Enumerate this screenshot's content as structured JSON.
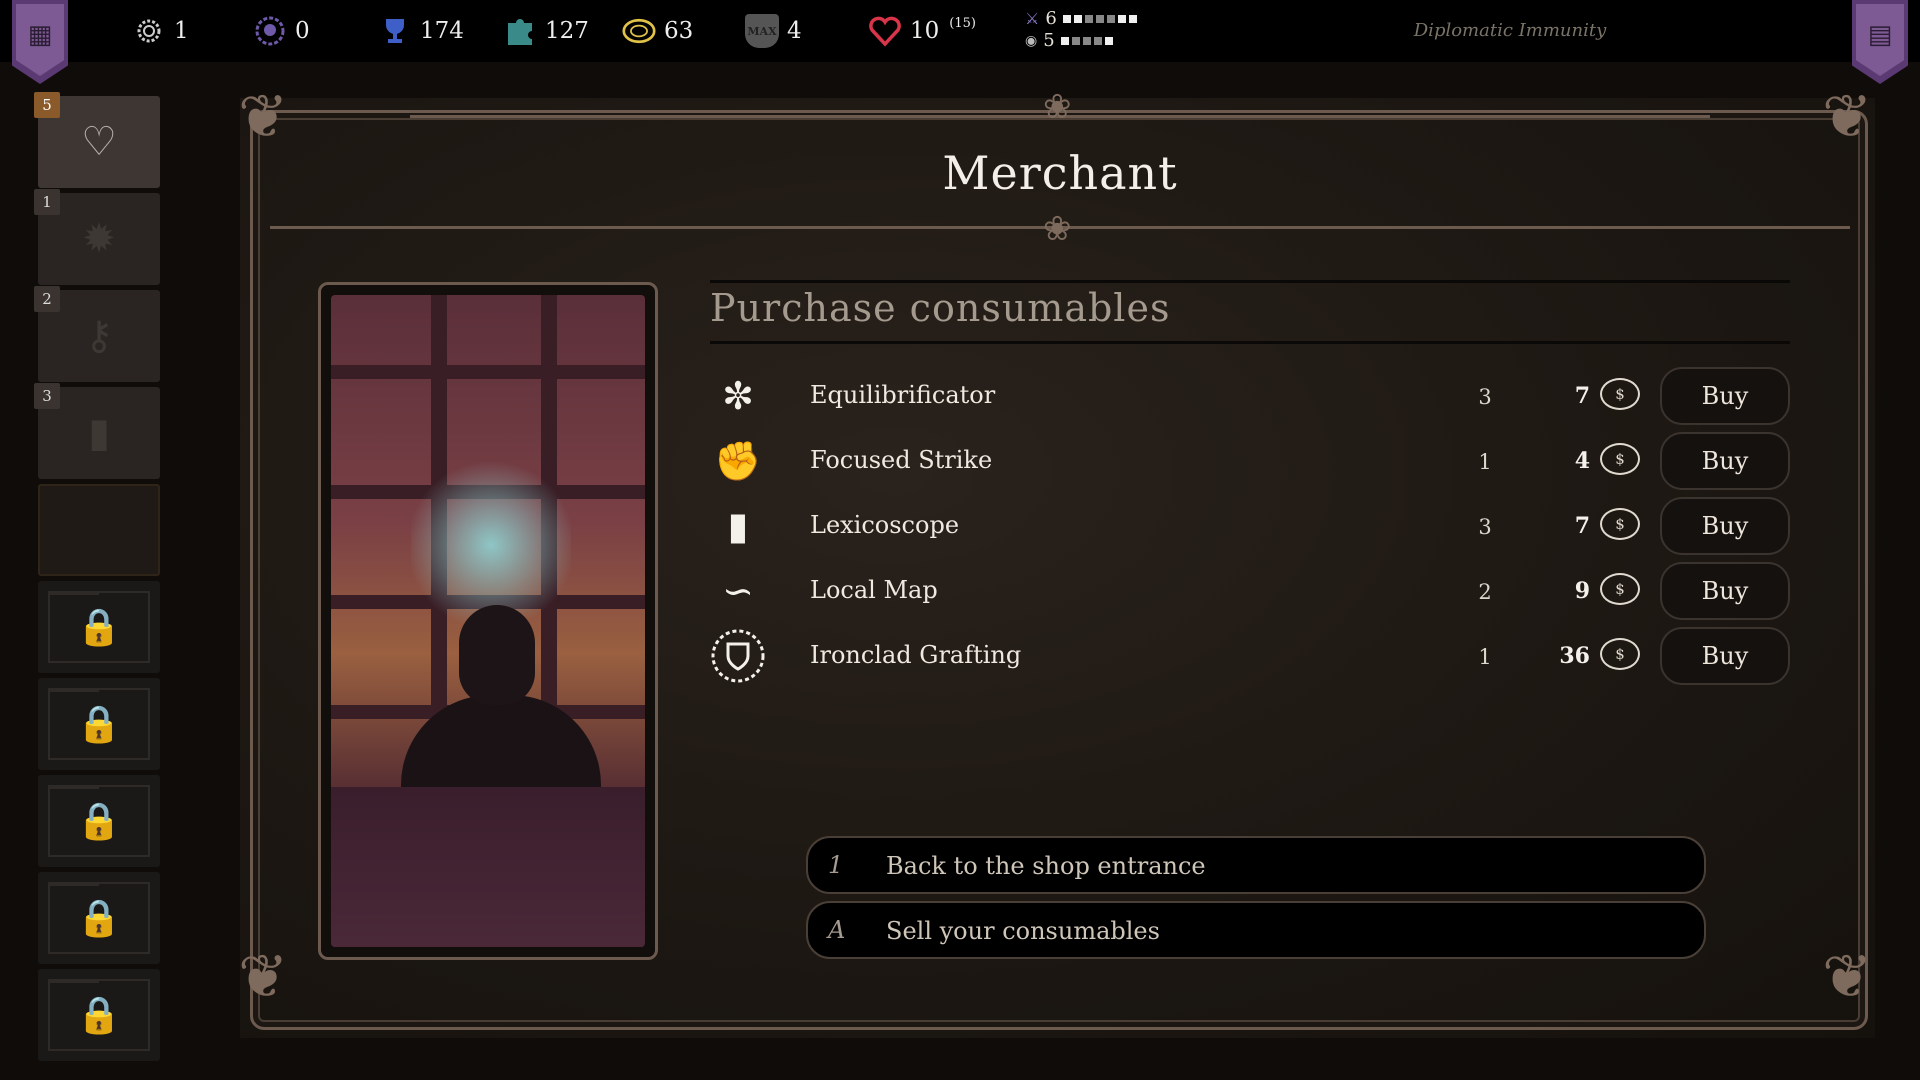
{
  "hud": {
    "gears": "1",
    "skulls": "0",
    "trophies": "174",
    "puzzle": "127",
    "coins": "63",
    "max": "4",
    "max_icon_label": "MAX",
    "hearts": "10",
    "hearts_max": "(15)",
    "attack": "6",
    "speed": "5",
    "location": "Diplomatic Immunity"
  },
  "sidebar": {
    "slots": [
      {
        "count": "5",
        "icon": "potion-heart-icon"
      },
      {
        "count": "1",
        "icon": "burst-icon"
      },
      {
        "count": "2",
        "icon": "key-icon"
      },
      {
        "count": "3",
        "icon": "bar-chart-icon"
      }
    ]
  },
  "panel": {
    "title": "Merchant",
    "section_title": "Purchase consumables"
  },
  "items": [
    {
      "name": "Equilibrificator",
      "qty": "3",
      "price": "7",
      "buy": "Buy",
      "icon": "swirl-icon"
    },
    {
      "name": "Focused Strike",
      "qty": "1",
      "price": "4",
      "buy": "Buy",
      "icon": "fist-icon"
    },
    {
      "name": "Lexicoscope",
      "qty": "3",
      "price": "7",
      "buy": "Buy",
      "icon": "book-icon"
    },
    {
      "name": "Local Map",
      "qty": "2",
      "price": "9",
      "buy": "Buy",
      "icon": "path-icon"
    },
    {
      "name": "Ironclad Grafting",
      "qty": "1",
      "price": "36",
      "buy": "Buy",
      "icon": "shield-icon"
    }
  ],
  "actions": [
    {
      "key": "1",
      "label": "Back to the shop entrance"
    },
    {
      "key": "A",
      "label": "Sell your consumables"
    }
  ],
  "colors": {
    "accent_purple": "#5b3a73",
    "frame": "#6b5a4d",
    "count_highlight": "#8b5a2b"
  }
}
